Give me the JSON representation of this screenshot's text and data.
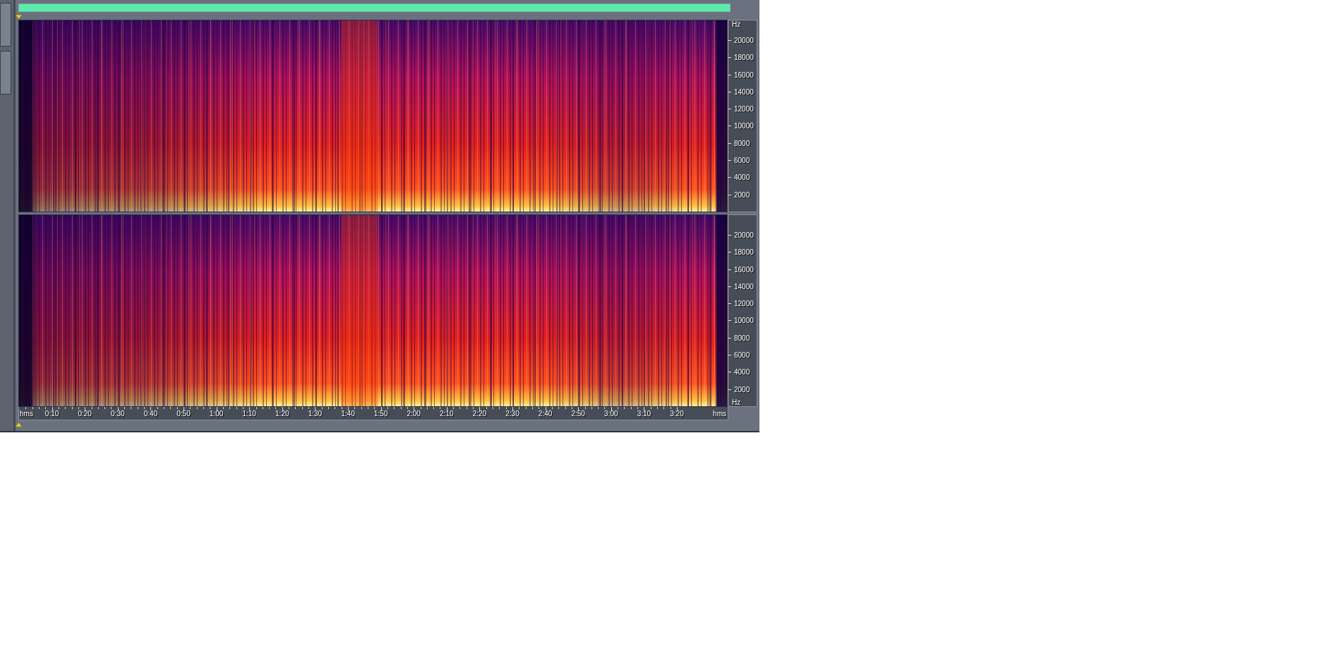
{
  "channels": [
    {
      "top_unit": "Hz",
      "freq_labels": [
        "20000",
        "18000",
        "16000",
        "14000",
        "12000",
        "10000",
        "8000",
        "6000",
        "4000",
        "2000"
      ]
    },
    {
      "freq_labels": [
        "20000",
        "18000",
        "16000",
        "14000",
        "12000",
        "10000",
        "8000",
        "6000",
        "4000",
        "2000"
      ],
      "bottom_unit": "Hz"
    }
  ],
  "time_axis": {
    "start_unit": "hms",
    "end_unit": "hms",
    "labels": [
      "0:10",
      "0:20",
      "0:30",
      "0:40",
      "0:50",
      "1:00",
      "1:10",
      "1:20",
      "1:30",
      "1:40",
      "1:50",
      "2:00",
      "2:10",
      "2:20",
      "2:30",
      "2:40",
      "2:50",
      "3:00",
      "3:10",
      "3:20"
    ]
  }
}
